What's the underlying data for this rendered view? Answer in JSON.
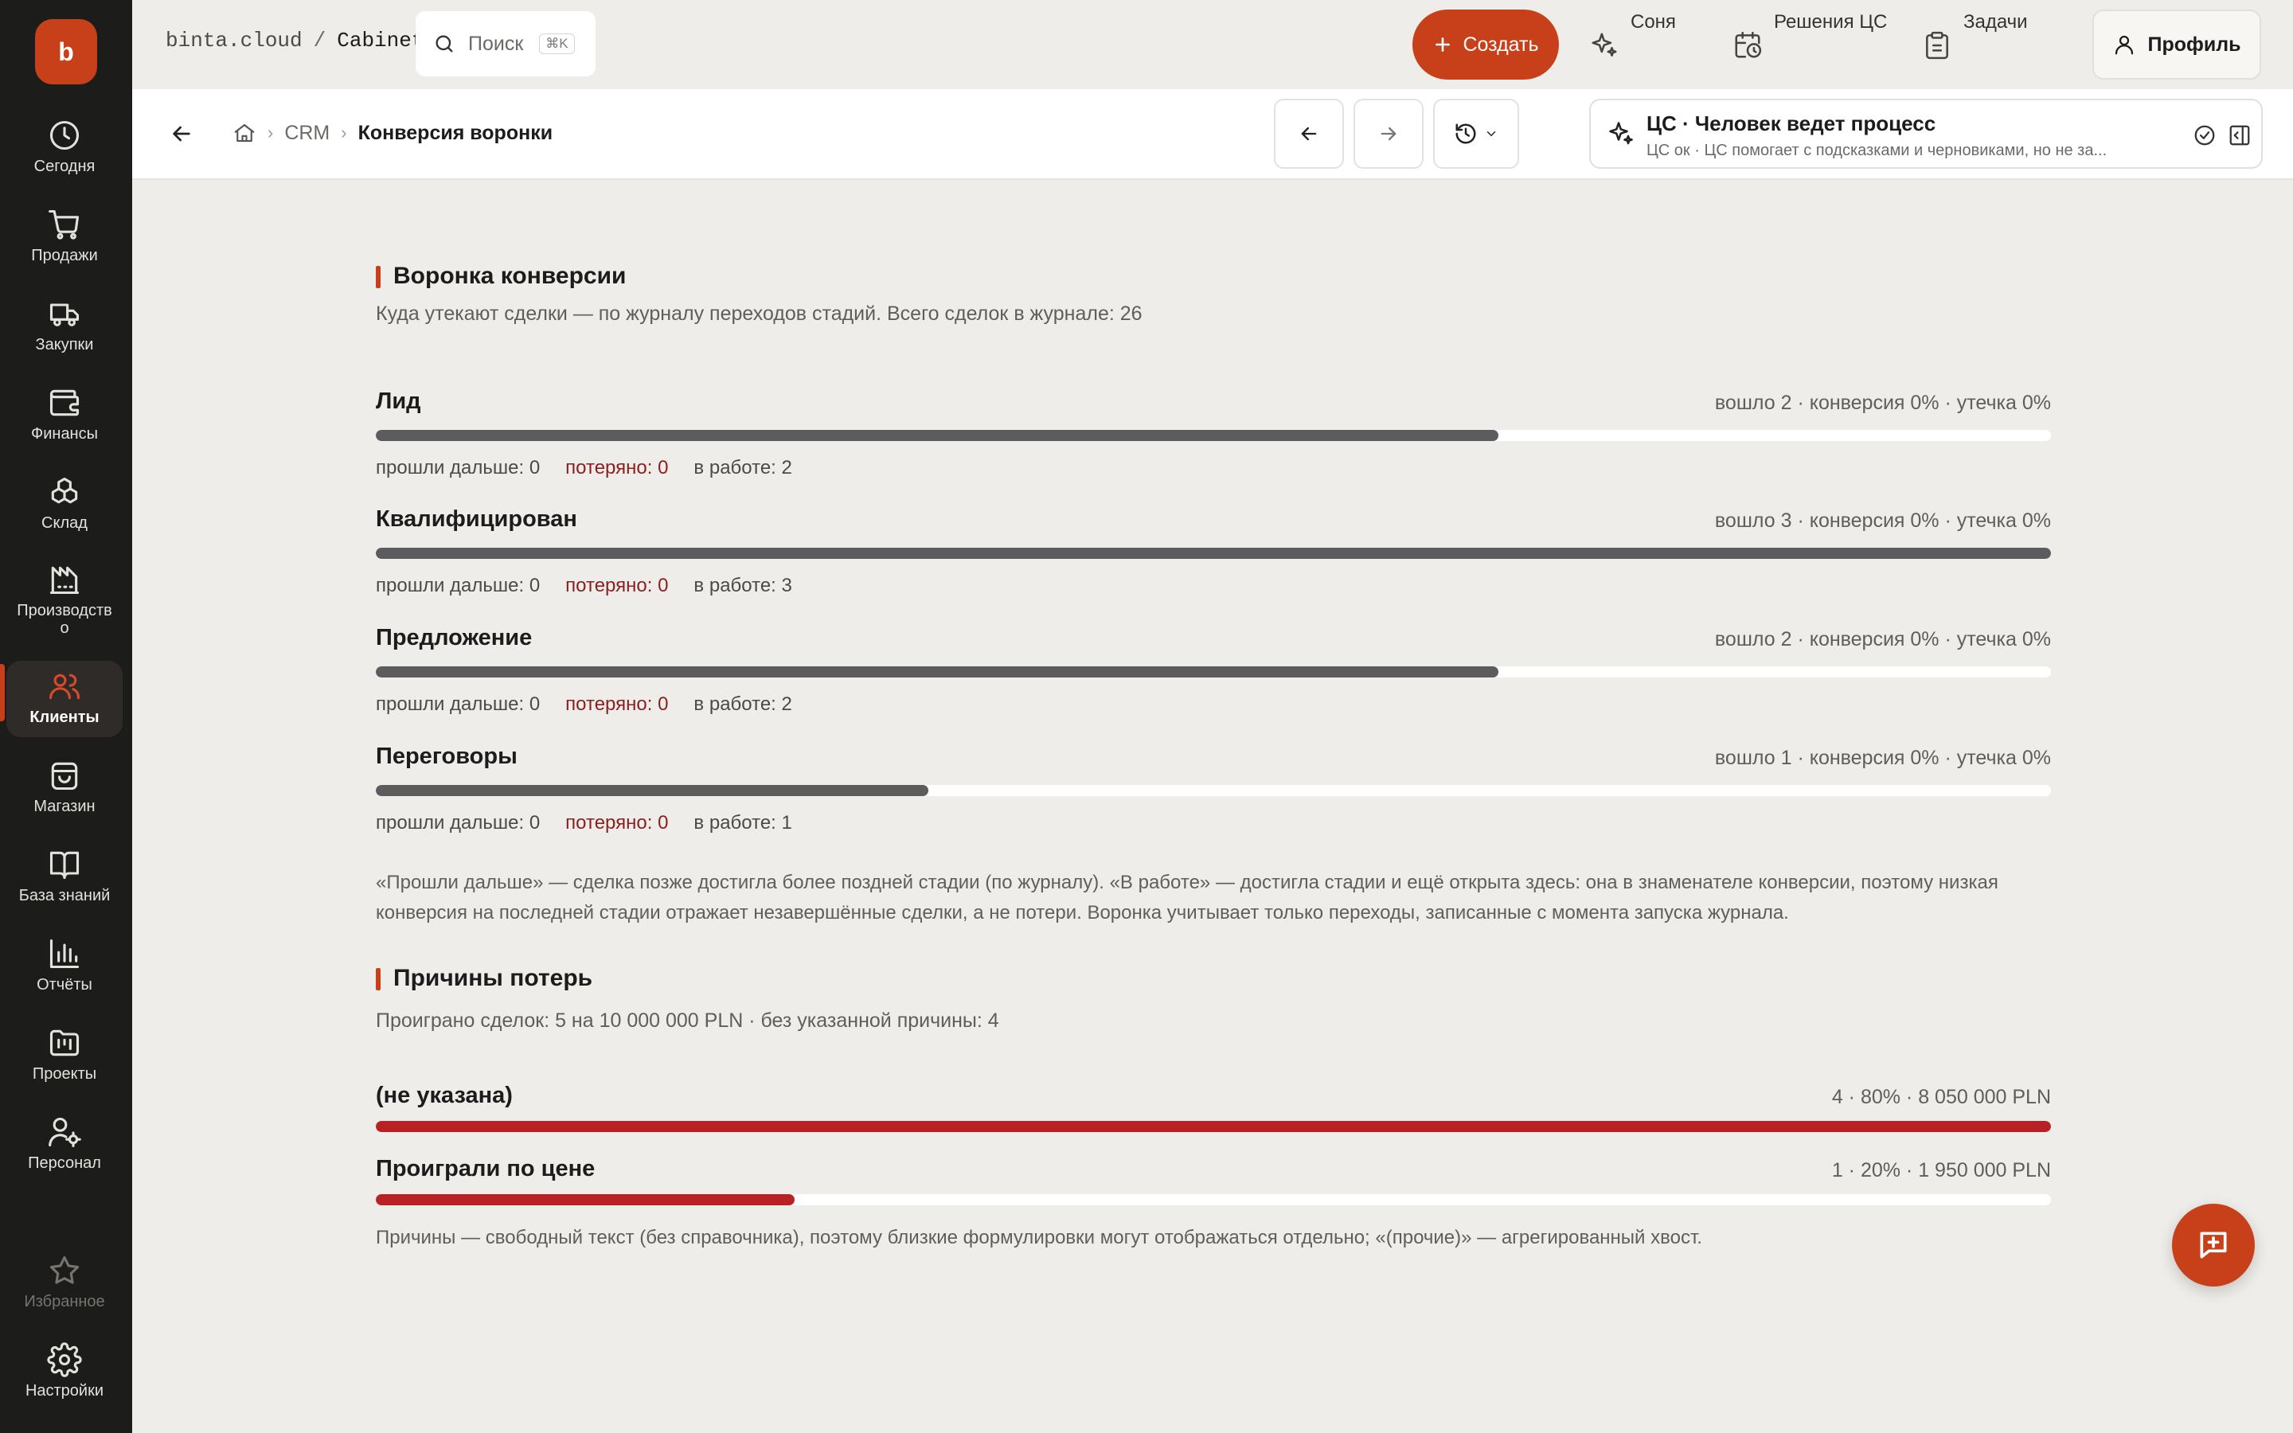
{
  "brand": {
    "name": "b",
    "domain": "binta.cloud",
    "separator": "/",
    "workspace": "Cabinet"
  },
  "sidebar": {
    "items": [
      {
        "label": "Сегодня",
        "icon": "clock-icon"
      },
      {
        "label": "Продажи",
        "icon": "cart-icon"
      },
      {
        "label": "Закупки",
        "icon": "truck-icon"
      },
      {
        "label": "Финансы",
        "icon": "wallet-icon"
      },
      {
        "label": "Склад",
        "icon": "boxes-icon"
      },
      {
        "label": "Производство",
        "icon": "factory-icon"
      },
      {
        "label": "Клиенты",
        "icon": "users-icon",
        "active": true
      },
      {
        "label": "Магазин",
        "icon": "shopping-bag-icon"
      },
      {
        "label": "База знаний",
        "icon": "book-icon"
      },
      {
        "label": "Отчёты",
        "icon": "bar-chart-icon"
      },
      {
        "label": "Проекты",
        "icon": "folder-kanban-icon"
      },
      {
        "label": "Персонал",
        "icon": "user-cog-icon"
      },
      {
        "label": "Избранное",
        "icon": "star-icon"
      },
      {
        "label": "Настройки",
        "icon": "gear-icon"
      }
    ]
  },
  "topbar": {
    "search_label": "Поиск",
    "search_shortcut": "⌘K",
    "create_label": "Создать",
    "links": [
      {
        "label": "Соня",
        "icon": "sparkles-icon"
      },
      {
        "label": "Решения ЦС",
        "icon": "calendar-clock-icon"
      },
      {
        "label": "Задачи",
        "icon": "clipboard-icon"
      }
    ],
    "profile_label": "Профиль"
  },
  "subheader": {
    "breadcrumb": {
      "section": "CRM",
      "current": "Конверсия воронки"
    },
    "ai": {
      "title": "ЦС · Человек ведет процесс",
      "subtitle": "ЦС ок · ЦС помогает с подсказками и черновиками, но не за..."
    }
  },
  "colors": {
    "accent": "#c8401a",
    "bar": "#5c5c5f",
    "loss_bar": "#b82224",
    "lost_text": "#8a1f1f"
  },
  "funnel": {
    "title": "Воронка конверсии",
    "subtitle": "Куда утекают сделки — по журналу переходов стадий. Всего сделок в журнале: 26",
    "stages": [
      {
        "name": "Лид",
        "stats": "вошло 2 · конверсия 0% · утечка 0%",
        "fill": 0.67,
        "passed": "прошли дальше: 0",
        "lost": "потеряно: 0",
        "in_progress": "в работе: 2"
      },
      {
        "name": "Квалифицирован",
        "stats": "вошло 3 · конверсия 0% · утечка 0%",
        "fill": 1.0,
        "passed": "прошли дальше: 0",
        "lost": "потеряно: 0",
        "in_progress": "в работе: 3"
      },
      {
        "name": "Предложение",
        "stats": "вошло 2 · конверсия 0% · утечка 0%",
        "fill": 0.67,
        "passed": "прошли дальше: 0",
        "lost": "потеряно: 0",
        "in_progress": "в работе: 2"
      },
      {
        "name": "Переговоры",
        "stats": "вошло 1 · конверсия 0% · утечка 0%",
        "fill": 0.33,
        "passed": "прошли дальше: 0",
        "lost": "потеряно: 0",
        "in_progress": "в работе: 1"
      }
    ],
    "note": "«Прошли дальше» — сделка позже достигла более поздней стадии (по журналу). «В работе» — достигла стадии и ещё открыта здесь: она в знаменателе конверсии, поэтому низкая конверсия на последней стадии отражает незавершённые сделки, а не потери. Воронка учитывает только переходы, записанные с момента запуска журнала."
  },
  "losses": {
    "title": "Причины потерь",
    "subtitle": "Проиграно сделок: 5 на 10 000 000 PLN · без указанной причины: 4",
    "reasons": [
      {
        "name": "(не указана)",
        "stats": "4 · 80% · 8 050 000 PLN",
        "fill": 1.0
      },
      {
        "name": "Проиграли по цене",
        "stats": "1 · 20% · 1 950 000 PLN",
        "fill": 0.25
      }
    ],
    "note": "Причины — свободный текст (без справочника), поэтому близкие формулировки могут отображаться отдельно; «(прочие)» — агрегированный хвост."
  }
}
